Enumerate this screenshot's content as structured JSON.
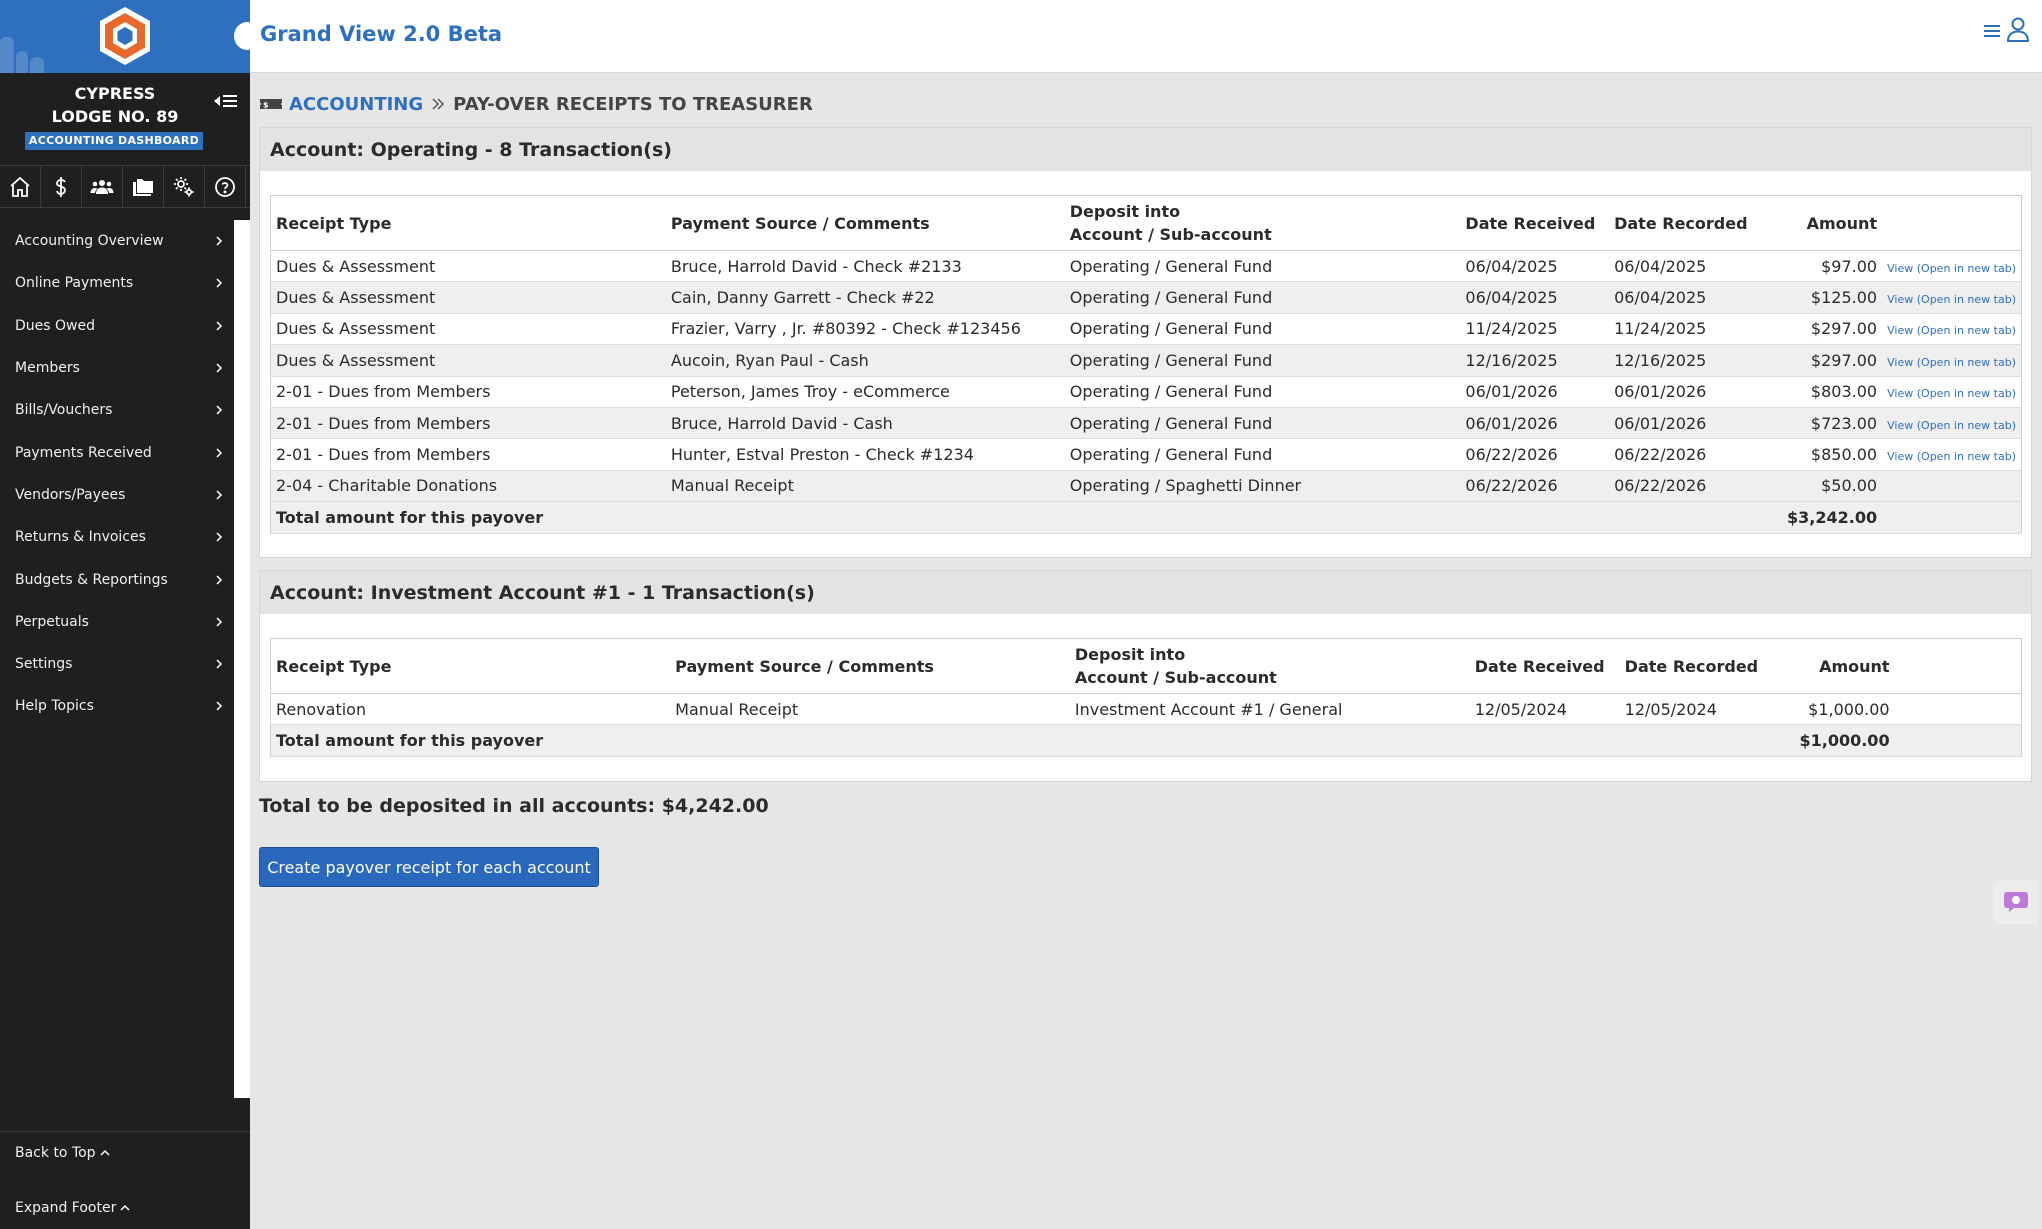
{
  "app": {
    "title": "Grand View 2.0 Beta"
  },
  "sidebar": {
    "lodge_line1": "CYPRESS",
    "lodge_line2": "LODGE NO. 89",
    "dashboard_badge": "ACCOUNTING DASHBOARD",
    "quick_icons": [
      "home-icon",
      "dollar-icon",
      "members-icon",
      "folder-icon",
      "settings-gears-icon",
      "help-icon"
    ],
    "items": [
      {
        "label": "Accounting Overview"
      },
      {
        "label": "Online Payments"
      },
      {
        "label": "Dues Owed"
      },
      {
        "label": "Members"
      },
      {
        "label": "Bills/Vouchers"
      },
      {
        "label": "Payments Received"
      },
      {
        "label": "Vendors/Payees"
      },
      {
        "label": "Returns & Invoices"
      },
      {
        "label": "Budgets & Reportings"
      },
      {
        "label": "Perpetuals"
      },
      {
        "label": "Settings"
      },
      {
        "label": "Help Topics"
      }
    ],
    "back_to_top": "Back to Top",
    "expand_footer": "Expand Footer"
  },
  "breadcrumb": {
    "section": "ACCOUNTING",
    "current": "PAY-OVER RECEIPTS TO TREASURER"
  },
  "columns": {
    "receipt_type": "Receipt Type",
    "payment_source": "Payment Source / Comments",
    "deposit_line1": "Deposit into",
    "deposit_line2": "Account / Sub-account",
    "date_received": "Date Received",
    "date_recorded": "Date Recorded",
    "amount": "Amount"
  },
  "accounts": [
    {
      "title": "Account: Operating - 8 Transaction(s)",
      "rows": [
        {
          "type": "Dues & Assessment",
          "source": "Bruce, Harrold David - Check #2133",
          "deposit": "Operating / General Fund",
          "received": "06/04/2025",
          "recorded": "06/04/2025",
          "amount": "$97.00",
          "link": "View (Open in new tab)"
        },
        {
          "type": "Dues & Assessment",
          "source": "Cain, Danny Garrett - Check #22",
          "deposit": "Operating / General Fund",
          "received": "06/04/2025",
          "recorded": "06/04/2025",
          "amount": "$125.00",
          "link": "View (Open in new tab)"
        },
        {
          "type": "Dues & Assessment",
          "source": "Frazier, Varry , Jr. #80392 - Check #123456",
          "deposit": "Operating / General Fund",
          "received": "11/24/2025",
          "recorded": "11/24/2025",
          "amount": "$297.00",
          "link": "View (Open in new tab)"
        },
        {
          "type": "Dues & Assessment",
          "source": "Aucoin, Ryan Paul - Cash",
          "deposit": "Operating / General Fund",
          "received": "12/16/2025",
          "recorded": "12/16/2025",
          "amount": "$297.00",
          "link": "View (Open in new tab)"
        },
        {
          "type": "2-01 - Dues from Members",
          "source": "Peterson, James Troy - eCommerce",
          "deposit": "Operating / General Fund",
          "received": "06/01/2026",
          "recorded": "06/01/2026",
          "amount": "$803.00",
          "link": "View (Open in new tab)"
        },
        {
          "type": "2-01 - Dues from Members",
          "source": "Bruce, Harrold David - Cash",
          "deposit": "Operating / General Fund",
          "received": "06/01/2026",
          "recorded": "06/01/2026",
          "amount": "$723.00",
          "link": "View (Open in new tab)"
        },
        {
          "type": "2-01 - Dues from Members",
          "source": "Hunter, Estval Preston - Check #1234",
          "deposit": "Operating / General Fund",
          "received": "06/22/2026",
          "recorded": "06/22/2026",
          "amount": "$850.00",
          "link": "View (Open in new tab)"
        },
        {
          "type": "2-04 - Charitable Donations",
          "source": "Manual Receipt",
          "deposit": "Operating / Spaghetti Dinner",
          "received": "06/22/2026",
          "recorded": "06/22/2026",
          "amount": "$50.00",
          "link": ""
        }
      ],
      "total_label": "Total amount for this payover",
      "total": "$3,242.00"
    },
    {
      "title": "Account: Investment Account #1 - 1 Transaction(s)",
      "rows": [
        {
          "type": "Renovation",
          "source": "Manual Receipt",
          "deposit": "Investment Account #1 / General",
          "received": "12/05/2024",
          "recorded": "12/05/2024",
          "amount": "$1,000.00",
          "link": ""
        }
      ],
      "total_label": "Total amount for this payover",
      "total": "$1,000.00"
    }
  ],
  "grand_total": "Total to be deposited in all accounts: $4,242.00",
  "create_button": "Create payover receipt for each account",
  "colors": {
    "brand_blue": "#2f6fbf",
    "logo_orange": "#e8672a",
    "sidebar_bg": "#1f1f1f"
  }
}
